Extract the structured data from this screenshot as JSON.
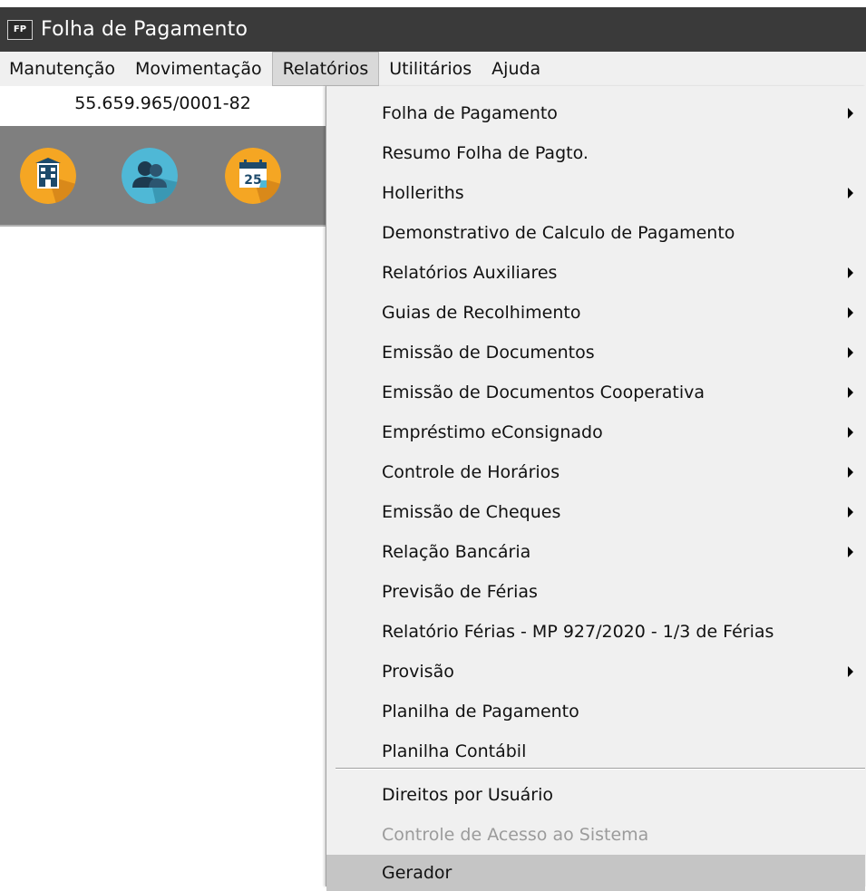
{
  "window": {
    "app_icon_text": "FP",
    "title": "Folha de Pagamento"
  },
  "menubar": {
    "items": [
      "Manutenção",
      "Movimentação",
      "Relatórios",
      "Utilitários",
      "Ajuda"
    ],
    "active": "Relatórios"
  },
  "company": {
    "cnpj": "55.659.965/0001-82"
  },
  "toolbar_icons": [
    {
      "name": "company-building-icon",
      "color": "#f5a623"
    },
    {
      "name": "employees-users-icon",
      "color": "#4fb8d6"
    },
    {
      "name": "calendar-icon",
      "color": "#f5a623",
      "text": "25"
    }
  ],
  "dropdown": {
    "items": [
      {
        "label": "Folha de Pagamento",
        "submenu": true,
        "disabled": false
      },
      {
        "label": "Resumo Folha de Pagto.",
        "submenu": false,
        "disabled": false
      },
      {
        "label": "Holleriths",
        "submenu": true,
        "disabled": false
      },
      {
        "label": "Demonstrativo de Calculo de Pagamento",
        "submenu": false,
        "disabled": false
      },
      {
        "label": "Relatórios Auxiliares",
        "submenu": true,
        "disabled": false
      },
      {
        "label": "Guias de Recolhimento",
        "submenu": true,
        "disabled": false
      },
      {
        "label": "Emissão de Documentos",
        "submenu": true,
        "disabled": false
      },
      {
        "label": "Emissão de Documentos Cooperativa",
        "submenu": true,
        "disabled": false
      },
      {
        "label": "Empréstimo eConsignado",
        "submenu": true,
        "disabled": false
      },
      {
        "label": "Controle de Horários",
        "submenu": true,
        "disabled": false
      },
      {
        "label": "Emissão de Cheques",
        "submenu": true,
        "disabled": false
      },
      {
        "label": "Relação Bancária",
        "submenu": true,
        "disabled": false
      },
      {
        "label": "Previsão de Férias",
        "submenu": false,
        "disabled": false
      },
      {
        "label": "Relatório Férias - MP 927/2020 - 1/3 de Férias",
        "submenu": false,
        "disabled": false
      },
      {
        "label": "Provisão",
        "submenu": true,
        "disabled": false
      },
      {
        "label": "Planilha de Pagamento",
        "submenu": false,
        "disabled": false
      },
      {
        "label": "Planilha Contábil",
        "submenu": false,
        "disabled": false
      },
      {
        "label": "Direitos por Usuário",
        "submenu": false,
        "disabled": false
      },
      {
        "label": "Controle de Acesso ao Sistema",
        "submenu": false,
        "disabled": true
      },
      {
        "label": "Gerador",
        "submenu": false,
        "disabled": false,
        "highlighted": true
      }
    ]
  },
  "colors": {
    "titlebar_bg": "#3a3a3a",
    "menu_bg": "#f0f0f0",
    "disabled_text": "#9b9b9b",
    "highlight_bg": "#c5c5c5"
  }
}
